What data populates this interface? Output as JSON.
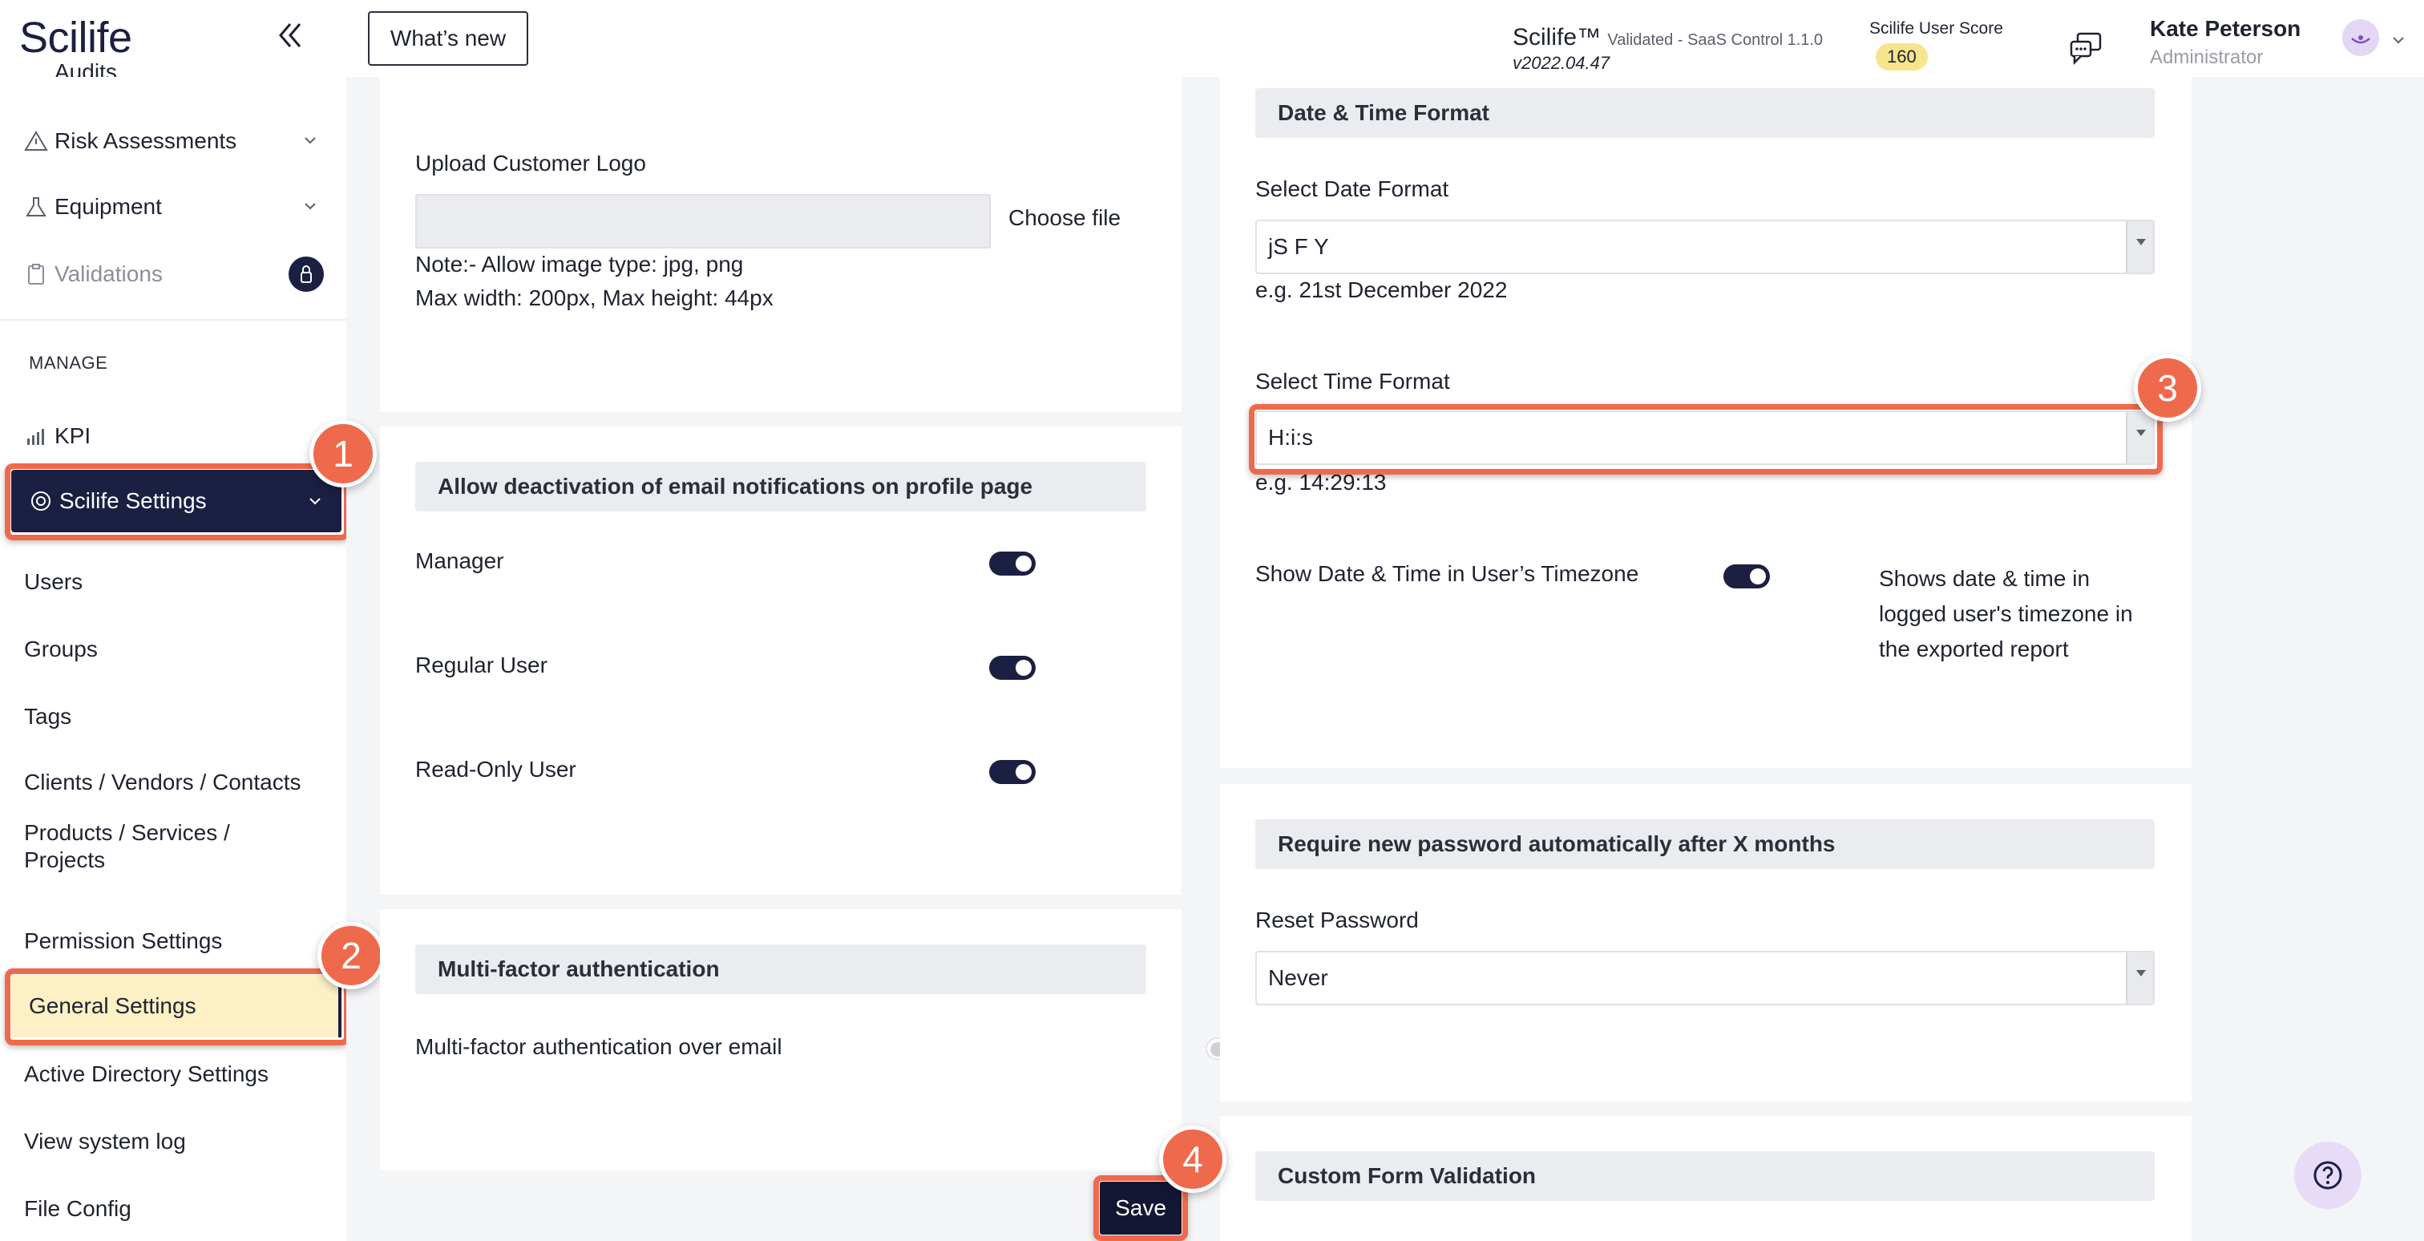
{
  "brand": {
    "logo": "Scilife"
  },
  "sidebar": {
    "items": [
      {
        "label": "Audits"
      },
      {
        "label": "Risk Assessments"
      },
      {
        "label": "Equipment"
      },
      {
        "label": "Validations"
      }
    ],
    "manage_label": "MANAGE",
    "kpi": "KPI",
    "scilife_settings": "Scilife Settings",
    "sub_items": [
      {
        "label": "Users"
      },
      {
        "label": "Groups"
      },
      {
        "label": "Tags"
      },
      {
        "label": "Clients / Vendors / Contacts"
      },
      {
        "label": "Products / Services /"
      },
      {
        "label": "Projects"
      },
      {
        "label": "Permission Settings"
      },
      {
        "label": "General Settings"
      },
      {
        "label": "Active Directory Settings"
      },
      {
        "label": "View system log"
      },
      {
        "label": "File Config"
      }
    ]
  },
  "topbar": {
    "whats_new": "What’s new",
    "product": "Scilife™",
    "product_sub": "Validated - SaaS Control 1.1.0",
    "version": "v2022.04.47",
    "score_label": "Scilife User Score",
    "score_value": "160",
    "user_name": "Kate Peterson",
    "user_role": "Administrator"
  },
  "logo_card": {
    "title": "Upload Customer Logo",
    "choose_file": "Choose file",
    "note1": "Note:- Allow image type: jpg, png",
    "note2": "Max width: 200px, Max height: 44px"
  },
  "email_card": {
    "header": "Allow deactivation of email notifications on profile page",
    "rows": [
      {
        "label": "Manager",
        "on": true
      },
      {
        "label": "Regular User",
        "on": true
      },
      {
        "label": "Read-Only User",
        "on": true
      }
    ]
  },
  "mfa_card": {
    "header": "Multi-factor authentication",
    "label": "Multi-factor authentication over email",
    "on": false
  },
  "datetime_card": {
    "header": "Date & Time Format",
    "date_label": "Select Date Format",
    "date_value": "jS F Y",
    "date_example": "e.g. 21st December 2022",
    "time_label": "Select Time Format",
    "time_value": "H:i:s",
    "time_example": "e.g. 14:29:13",
    "tz_label": "Show Date & Time in User’s Timezone",
    "tz_on": true,
    "tz_help": [
      "Shows date & time in",
      "logged user's timezone in",
      "the exported report"
    ]
  },
  "password_card": {
    "header": "Require new password automatically after X months",
    "label": "Reset Password",
    "value": "Never"
  },
  "custom_form_card": {
    "header": "Custom Form Validation"
  },
  "save_label": "Save",
  "steps": [
    "1",
    "2",
    "3",
    "4"
  ],
  "colors": {
    "navy": "#1b2042",
    "highlight": "#ef6a4c",
    "selected_bg": "#fdf0c4"
  }
}
